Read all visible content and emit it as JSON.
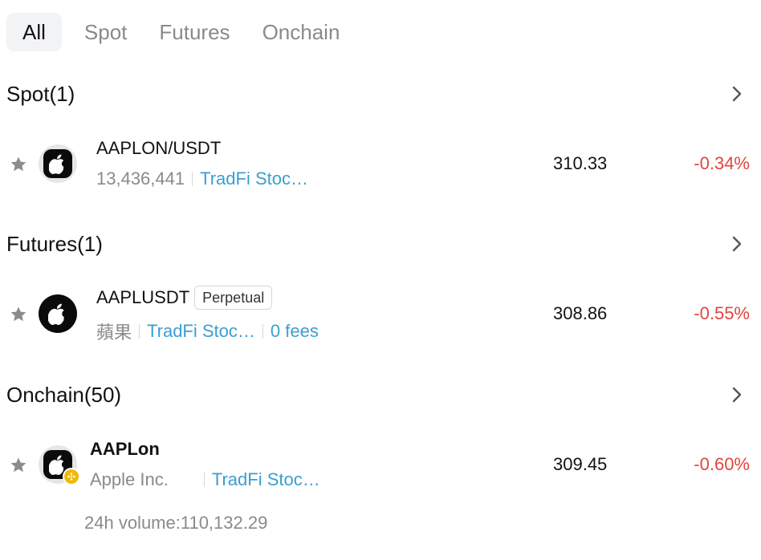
{
  "tabs": [
    {
      "label": "All",
      "active": true
    },
    {
      "label": "Spot",
      "active": false
    },
    {
      "label": "Futures",
      "active": false
    },
    {
      "label": "Onchain",
      "active": false
    }
  ],
  "sections": {
    "spot": {
      "title": "Spot(1)",
      "item": {
        "pair": "AAPLON/USDT",
        "volume": "13,436,441",
        "tag": "TradFi Stoc…",
        "price": "310.33",
        "change": "-0.34%"
      }
    },
    "futures": {
      "title": "Futures(1)",
      "item": {
        "pair": "AAPLUSDT",
        "badge": "Perpetual",
        "name": "蘋果",
        "tag": "TradFi Stoc…",
        "fees": "0 fees",
        "price": "308.86",
        "change": "-0.55%"
      }
    },
    "onchain": {
      "title": "Onchain(50)",
      "item": {
        "symbol": "AAPLon",
        "name": "Apple Inc.",
        "tag": "TradFi Stoc…",
        "price": "309.45",
        "change": "-0.60%",
        "volume": "24h volume:110,132.29"
      }
    }
  },
  "colors": {
    "negative": "#e0463e",
    "link": "#3a9fd1",
    "muted": "#8a8a8a",
    "chain_badge": "#f0b90b"
  },
  "icons": {
    "star": "star-icon",
    "chevron": "chevron-right-icon",
    "asset": "apple-logo-icon",
    "chain": "bnb-chain-icon"
  }
}
